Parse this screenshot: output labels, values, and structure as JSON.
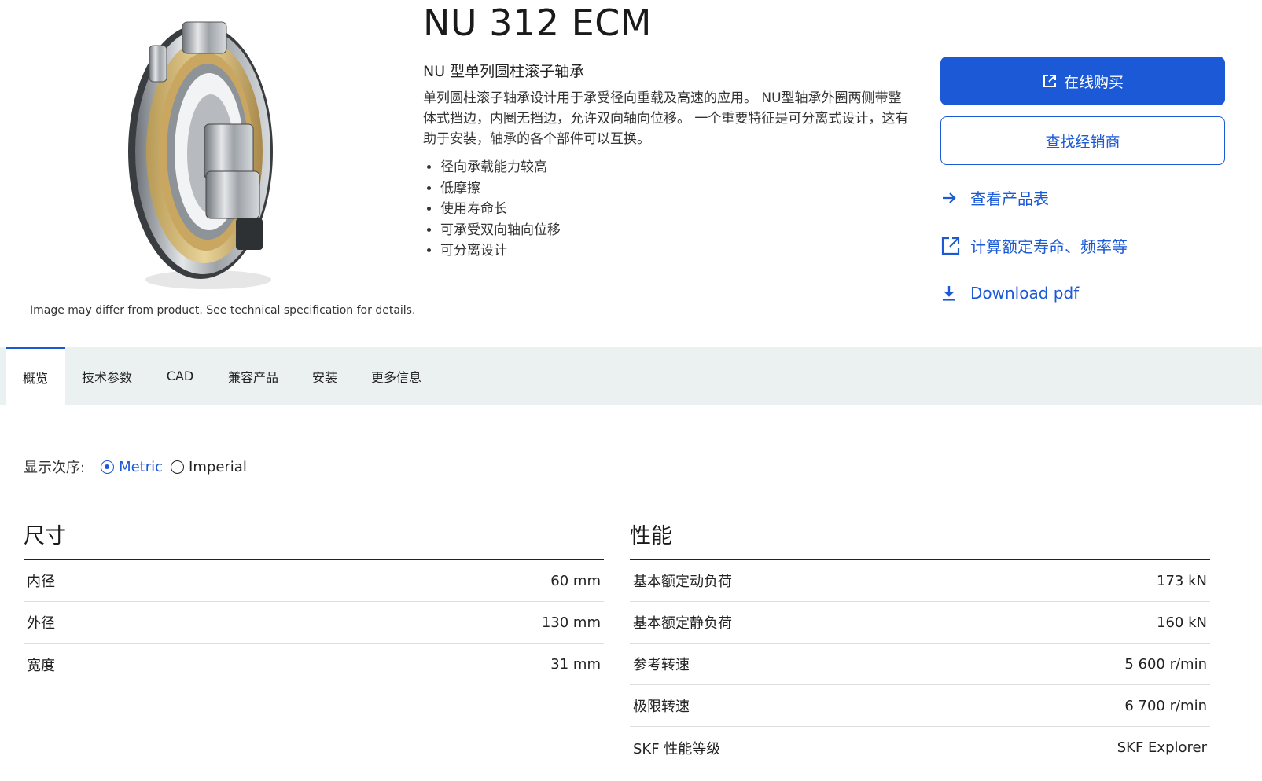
{
  "product": {
    "title": "NU 312 ECM",
    "subtitle": "NU 型单列圆柱滚子轴承",
    "description": "单列圆柱滚子轴承设计用于承受径向重载及高速的应用。 NU型轴承外圈两侧带整体式挡边，内圈无挡边，允许双向轴向位移。 一个重要特征是可分离式设计，这有助于安装，轴承的各个部件可以互换。",
    "features": [
      "径向承载能力较高",
      "低摩擦",
      "使用寿命长",
      "可承受双向轴向位移",
      "可分离设计"
    ],
    "image_note": "Image may differ from product. See technical specification for details."
  },
  "actions": {
    "buy_label": "在线购买",
    "dealer_label": "查找经销商",
    "product_table_label": "查看产品表",
    "calculate_label": "计算额定寿命、频率等",
    "download_label": "Download pdf"
  },
  "tabs": [
    {
      "label": "概览",
      "active": true
    },
    {
      "label": "技术参数",
      "active": false
    },
    {
      "label": "CAD",
      "active": false
    },
    {
      "label": "兼容产品",
      "active": false
    },
    {
      "label": "安装",
      "active": false
    },
    {
      "label": "更多信息",
      "active": false
    }
  ],
  "units": {
    "label": "显示次序:",
    "options": [
      {
        "label": "Metric",
        "checked": true
      },
      {
        "label": "Imperial",
        "checked": false
      }
    ]
  },
  "dimensions": {
    "title": "尺寸",
    "rows": [
      {
        "label": "内径",
        "value": "60 mm"
      },
      {
        "label": "外径",
        "value": "130 mm"
      },
      {
        "label": "宽度",
        "value": "31 mm"
      }
    ]
  },
  "performance": {
    "title": "性能",
    "rows": [
      {
        "label": "基本额定动负荷",
        "value": "173 kN"
      },
      {
        "label": "基本额定静负荷",
        "value": "160 kN"
      },
      {
        "label": "参考转速",
        "value": "5 600 r/min"
      },
      {
        "label": "极限转速",
        "value": "6 700 r/min"
      },
      {
        "label": "SKF 性能等级",
        "value": "SKF Explorer"
      }
    ]
  },
  "colors": {
    "accent": "#1c59d6",
    "tab_bar": "#ebf0f0"
  }
}
